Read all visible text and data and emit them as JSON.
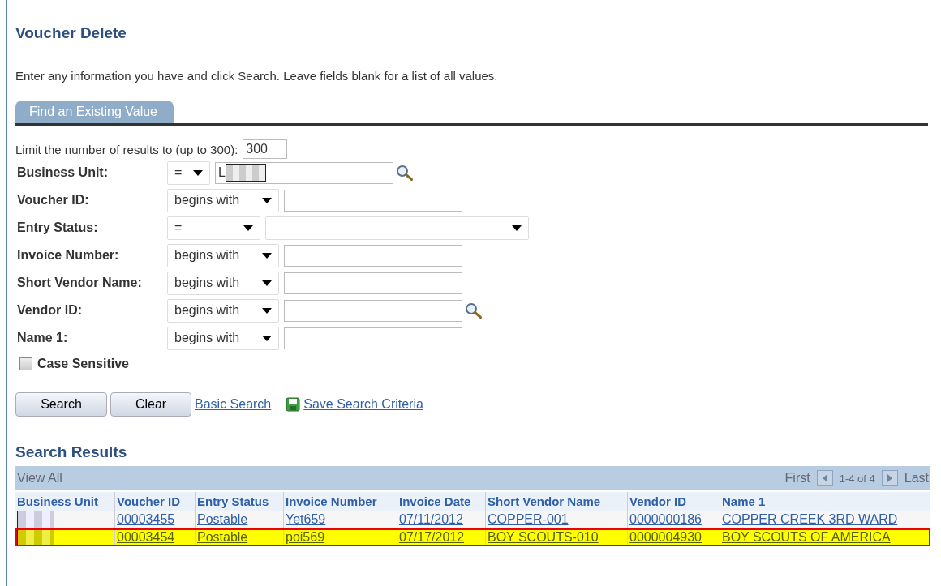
{
  "title": "Voucher Delete",
  "instructions": "Enter any information you have and click Search. Leave fields blank for a list of all values.",
  "tabs": [
    {
      "label": "Find an Existing Value",
      "selected": true
    }
  ],
  "limit": {
    "label": "Limit the number of results to (up to 300):",
    "value": "300"
  },
  "criteria": [
    {
      "label": "Business Unit:",
      "operator": "=",
      "kind": "lookup",
      "value": "L",
      "redacted": true
    },
    {
      "label": "Voucher ID:",
      "operator": "begins with",
      "kind": "text"
    },
    {
      "label": "Entry Status:",
      "operator": "=",
      "kind": "dropdown"
    },
    {
      "label": "Invoice Number:",
      "operator": "begins with",
      "kind": "text"
    },
    {
      "label": "Short Vendor Name:",
      "operator": "begins with",
      "kind": "text"
    },
    {
      "label": "Vendor ID:",
      "operator": "begins with",
      "kind": "lookup"
    },
    {
      "label": "Name 1:",
      "operator": "begins with",
      "kind": "text"
    }
  ],
  "case_sensitive": {
    "label": "Case Sensitive",
    "checked": false
  },
  "buttons": [
    "Search",
    "Clear"
  ],
  "links": [
    {
      "label": "Basic Search",
      "kind": "plain"
    },
    {
      "label": "Save Search Criteria",
      "kind": "save"
    }
  ],
  "results": {
    "heading": "Search Results",
    "view_all": "View All",
    "first": "First",
    "range": "1-4 of 4",
    "last": "Last",
    "columns": [
      "Business Unit",
      "Voucher ID",
      "Entry Status",
      "Invoice Number",
      "Invoice Date",
      "Short Vendor Name",
      "Vendor ID",
      "Name 1"
    ],
    "rows": [
      {
        "selected": false,
        "redacted": true,
        "cells": [
          "",
          "00003455",
          "Postable",
          "Yet659",
          "07/11/2012",
          "COPPER-001",
          "0000000186",
          "COPPER CREEK 3RD WARD"
        ]
      },
      {
        "selected": true,
        "redacted": true,
        "cells": [
          "",
          "00003454",
          "Postable",
          "poi569",
          "07/17/2012",
          "BOY SCOUTS-010",
          "0000004930",
          "BOY SCOUTS OF AMERICA"
        ]
      }
    ]
  }
}
